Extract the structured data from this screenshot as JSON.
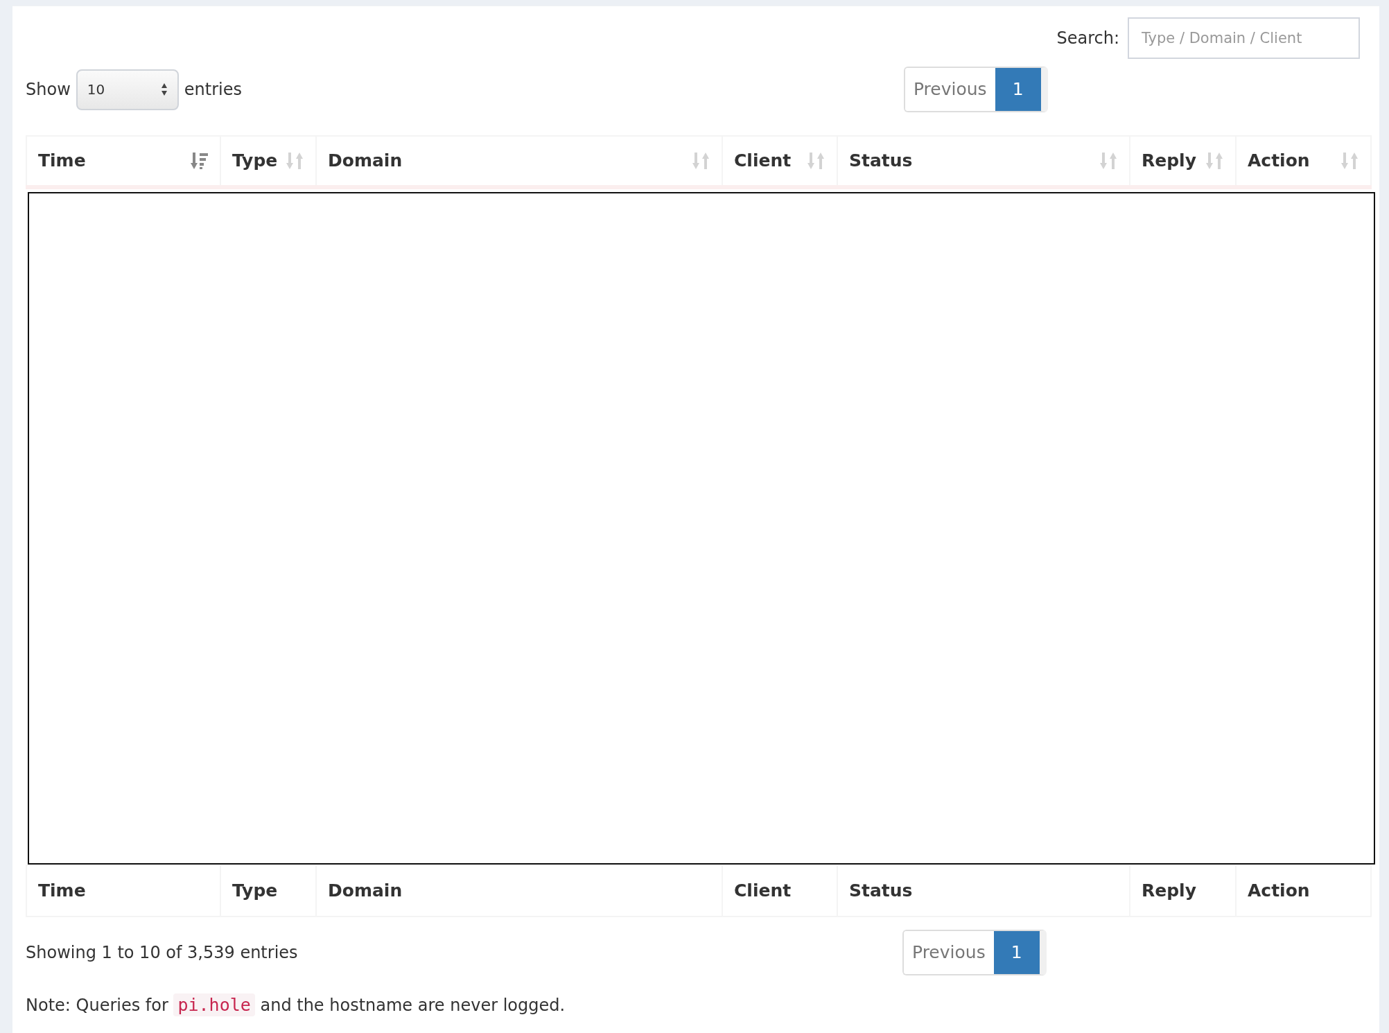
{
  "length": {
    "prefix": "Show",
    "value": "10",
    "suffix": "entries"
  },
  "search": {
    "label": "Search:",
    "placeholder": "Type / Domain / Client"
  },
  "pagination_top": [
    {
      "label": "Previous",
      "selected": false
    },
    {
      "label": "1",
      "selected": true
    }
  ],
  "table": {
    "columns": [
      {
        "label": "Time",
        "sorted": true
      },
      {
        "label": "Type",
        "sorted": false
      },
      {
        "label": "Domain",
        "sorted": false
      },
      {
        "label": "Client",
        "sorted": false
      },
      {
        "label": "Status",
        "sorted": false
      },
      {
        "label": "Reply",
        "sorted": false
      },
      {
        "label": "Action",
        "sorted": false
      }
    ],
    "footer": [
      "Time",
      "Type",
      "Domain",
      "Client",
      "Status",
      "Reply",
      "Action"
    ]
  },
  "info": "Showing 1 to 10 of 3,539 entries",
  "pagination_bottom": [
    {
      "label": "Previous",
      "selected": false
    },
    {
      "label": "1",
      "selected": true
    }
  ],
  "note": {
    "before": "Note: Queries for",
    "code": "pi.hole",
    "after": "and the hostname are never logged."
  }
}
